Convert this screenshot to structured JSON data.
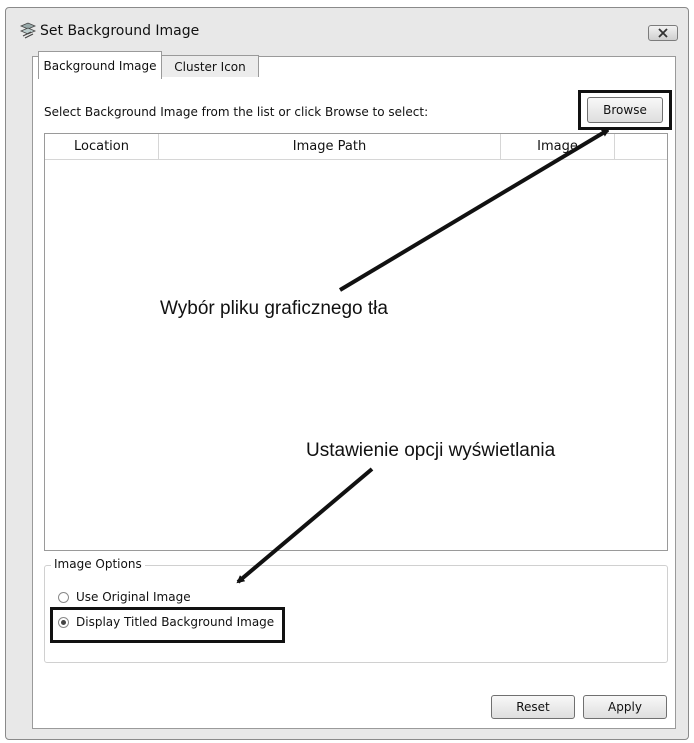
{
  "window": {
    "title": "Set Background Image",
    "icon": "background-image-icon",
    "close_icon": "close-icon"
  },
  "tabs": [
    {
      "label": "Background Image",
      "active": true
    },
    {
      "label": "Cluster Icon",
      "active": false
    }
  ],
  "main": {
    "instructions": "Select Background Image from the list or click Browse to select:",
    "browse_label": "Browse",
    "columns": [
      "Location",
      "Image Path",
      "Image"
    ]
  },
  "options": {
    "group_label": "Image Options",
    "radios": [
      {
        "label": "Use Original Image",
        "checked": false
      },
      {
        "label": "Display Titled Background Image",
        "checked": true
      }
    ]
  },
  "footer": {
    "reset_label": "Reset",
    "apply_label": "Apply"
  },
  "annotations": {
    "browse_note": "Wybór pliku graficznego tła",
    "options_note": "Ustawienie opcji wyświetlania"
  },
  "colors": {
    "highlight_border": "#111111",
    "window_bg": "#e8e8e8"
  }
}
